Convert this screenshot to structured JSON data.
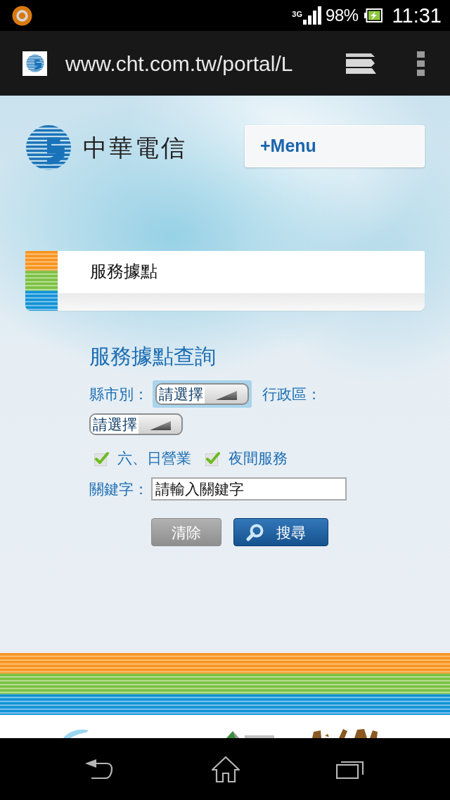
{
  "status_bar": {
    "network": "3G",
    "battery": "98%",
    "time": "11:31"
  },
  "browser_bar": {
    "url": "www.cht.com.tw/portal/L"
  },
  "site_header": {
    "logo_text": "中華電信",
    "menu_button": "+Menu"
  },
  "section_header": {
    "title": "服務據點"
  },
  "search_form": {
    "heading": "服務據點查詢",
    "county": {
      "label": "縣市別：",
      "select": {
        "value": "請選擇",
        "focused": true
      }
    },
    "district": {
      "label": "行政區：",
      "select": {
        "value": "請選擇",
        "focused": false
      }
    },
    "options": [
      {
        "label": "六、日營業",
        "checked": true
      },
      {
        "label": "夜間服務",
        "checked": true
      }
    ],
    "keyword": {
      "label": "關鍵字：",
      "value": "請輸入關鍵字"
    },
    "buttons": [
      {
        "label": "清除",
        "kind": "clear"
      },
      {
        "label": "搜尋",
        "kind": "search"
      }
    ]
  }
}
